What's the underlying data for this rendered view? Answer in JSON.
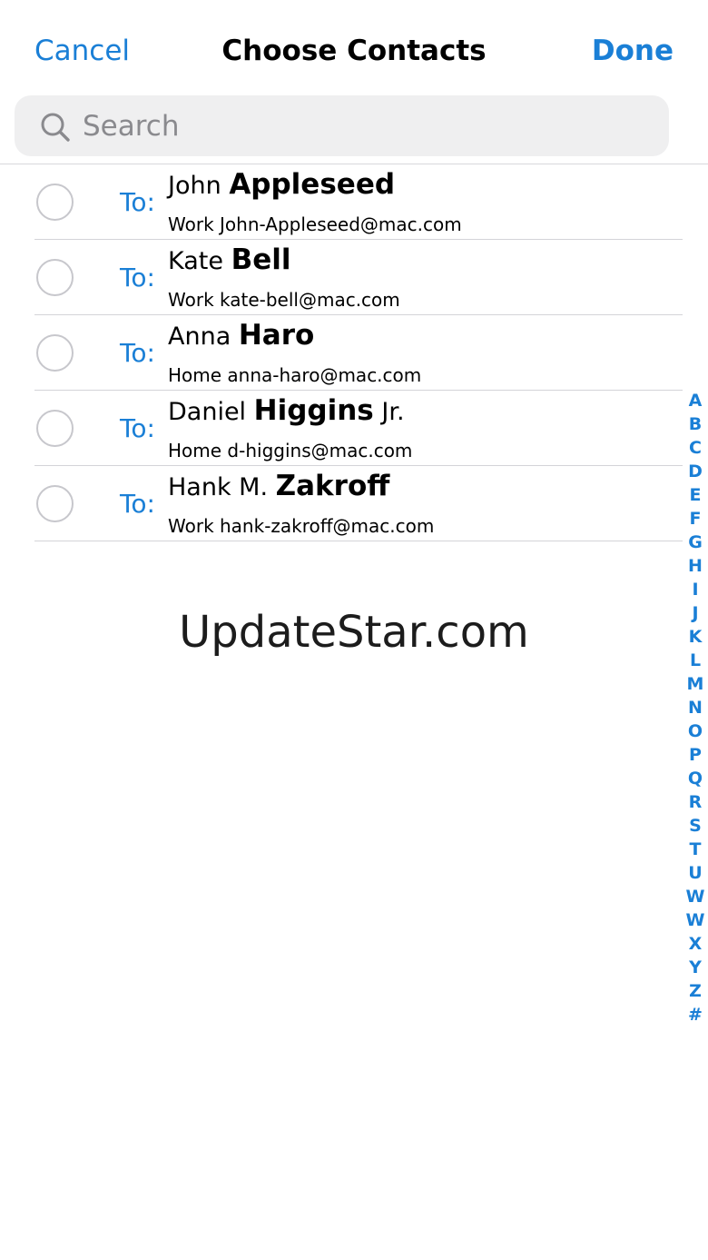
{
  "navbar": {
    "cancel_label": "Cancel",
    "title": "Choose Contacts",
    "done_label": "Done"
  },
  "search": {
    "placeholder": "Search",
    "value": ""
  },
  "contacts": [
    {
      "to": "To:",
      "first": "John",
      "last": "Appleseed",
      "suffix": "",
      "detail": "Work John-Appleseed@mac.com"
    },
    {
      "to": "To:",
      "first": "Kate",
      "last": "Bell",
      "suffix": "",
      "detail": "Work kate-bell@mac.com"
    },
    {
      "to": "To:",
      "first": "Anna",
      "last": "Haro",
      "suffix": "",
      "detail": "Home anna-haro@mac.com"
    },
    {
      "to": "To:",
      "first": "Daniel",
      "last": "Higgins",
      "suffix": "Jr.",
      "detail": "Home d-higgins@mac.com"
    },
    {
      "to": "To:",
      "first": "Hank M.",
      "last": "Zakroff",
      "suffix": "",
      "detail": "Work hank-zakroff@mac.com"
    }
  ],
  "watermark": "UpdateStar.com",
  "index_letters": [
    "A",
    "B",
    "C",
    "D",
    "E",
    "F",
    "G",
    "H",
    "I",
    "J",
    "K",
    "L",
    "M",
    "N",
    "O",
    "P",
    "Q",
    "R",
    "S",
    "T",
    "U",
    "W",
    "W",
    "X",
    "Y",
    "Z",
    "#"
  ],
  "colors": {
    "accent": "#1a7fd6",
    "search_bg": "#efeff0",
    "divider": "#d4d4d8"
  }
}
